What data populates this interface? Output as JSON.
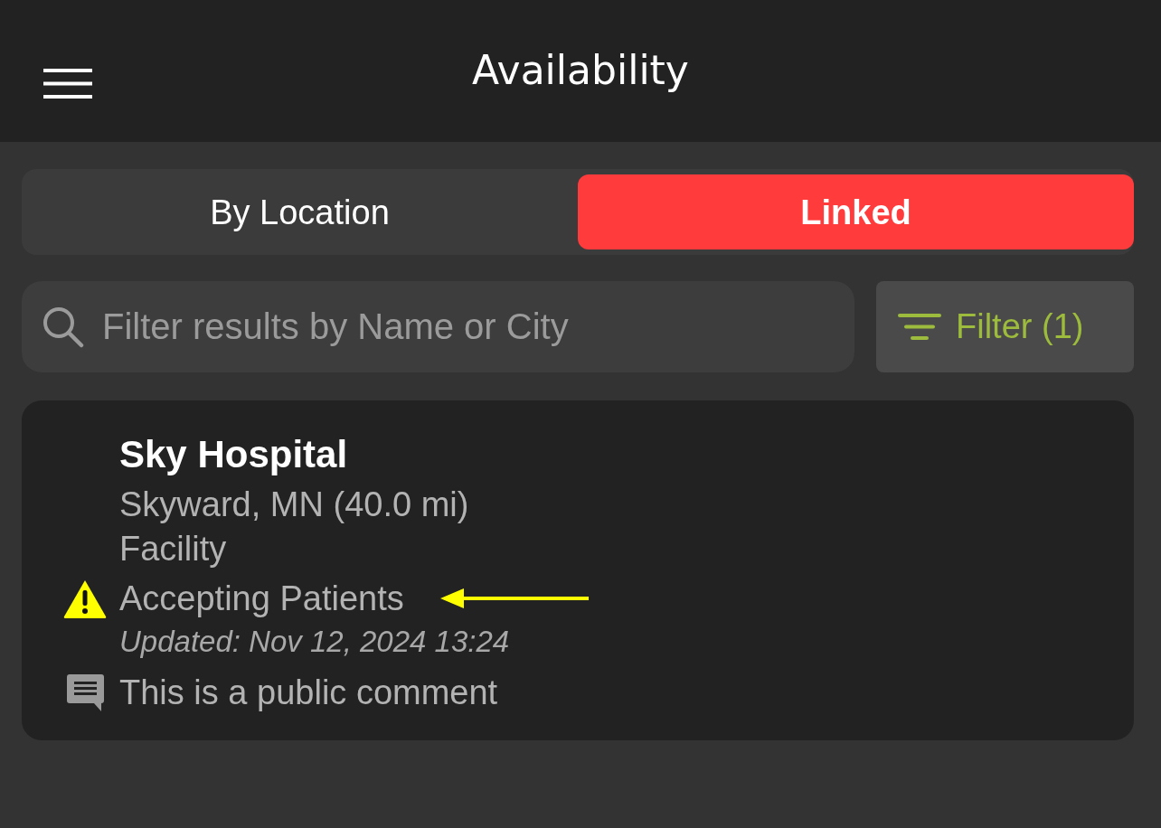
{
  "header": {
    "title": "Availability"
  },
  "tabs": [
    {
      "label": "By Location",
      "selected": false
    },
    {
      "label": "Linked",
      "selected": true
    }
  ],
  "search": {
    "placeholder": "Filter results by Name or City"
  },
  "filter_button": {
    "label": "Filter (1)"
  },
  "results": [
    {
      "name": "Sky Hospital",
      "location": "Skyward, MN (40.0 mi)",
      "type": "Facility",
      "status": "Accepting Patients",
      "updated": "Updated: Nov 12, 2024 13:24",
      "comment": "This is a public comment"
    }
  ]
}
